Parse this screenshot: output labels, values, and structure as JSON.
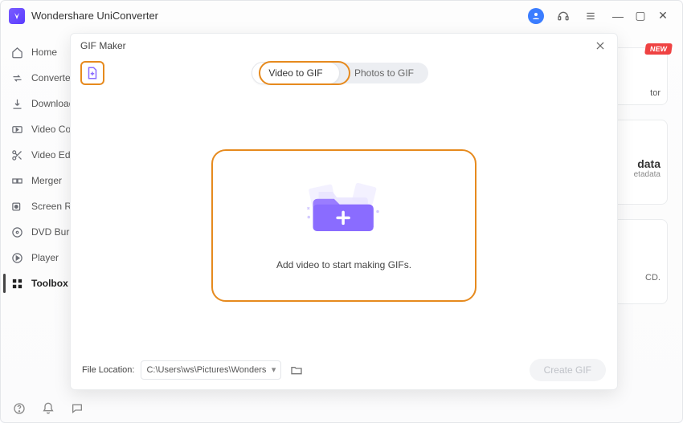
{
  "app": {
    "title": "Wondershare UniConverter"
  },
  "window": {
    "min": "—",
    "max": "▢",
    "close": "✕"
  },
  "sidebar": {
    "items": [
      {
        "icon": "home",
        "label": "Home"
      },
      {
        "icon": "convert",
        "label": "Converter"
      },
      {
        "icon": "download",
        "label": "Downloader"
      },
      {
        "icon": "compress",
        "label": "Video Compressor"
      },
      {
        "icon": "edit",
        "label": "Video Editor"
      },
      {
        "icon": "merge",
        "label": "Merger"
      },
      {
        "icon": "record",
        "label": "Screen Recorder"
      },
      {
        "icon": "dvd",
        "label": "DVD Burner"
      },
      {
        "icon": "play",
        "label": "Player"
      },
      {
        "icon": "toolbox",
        "label": "Toolbox"
      }
    ]
  },
  "rightpanels": {
    "new_badge": "NEW",
    "p1_line": "tor",
    "p2_title": "data",
    "p2_line": "etadata",
    "p3_line": "CD."
  },
  "modal": {
    "title": "GIF Maker",
    "tabs": {
      "video": "Video to GIF",
      "photos": "Photos to GIF"
    },
    "drop_text": "Add video to start making GIFs.",
    "footer": {
      "label": "File Location:",
      "path": "C:\\Users\\ws\\Pictures\\Wonders",
      "chev": "▾",
      "create": "Create GIF"
    }
  }
}
